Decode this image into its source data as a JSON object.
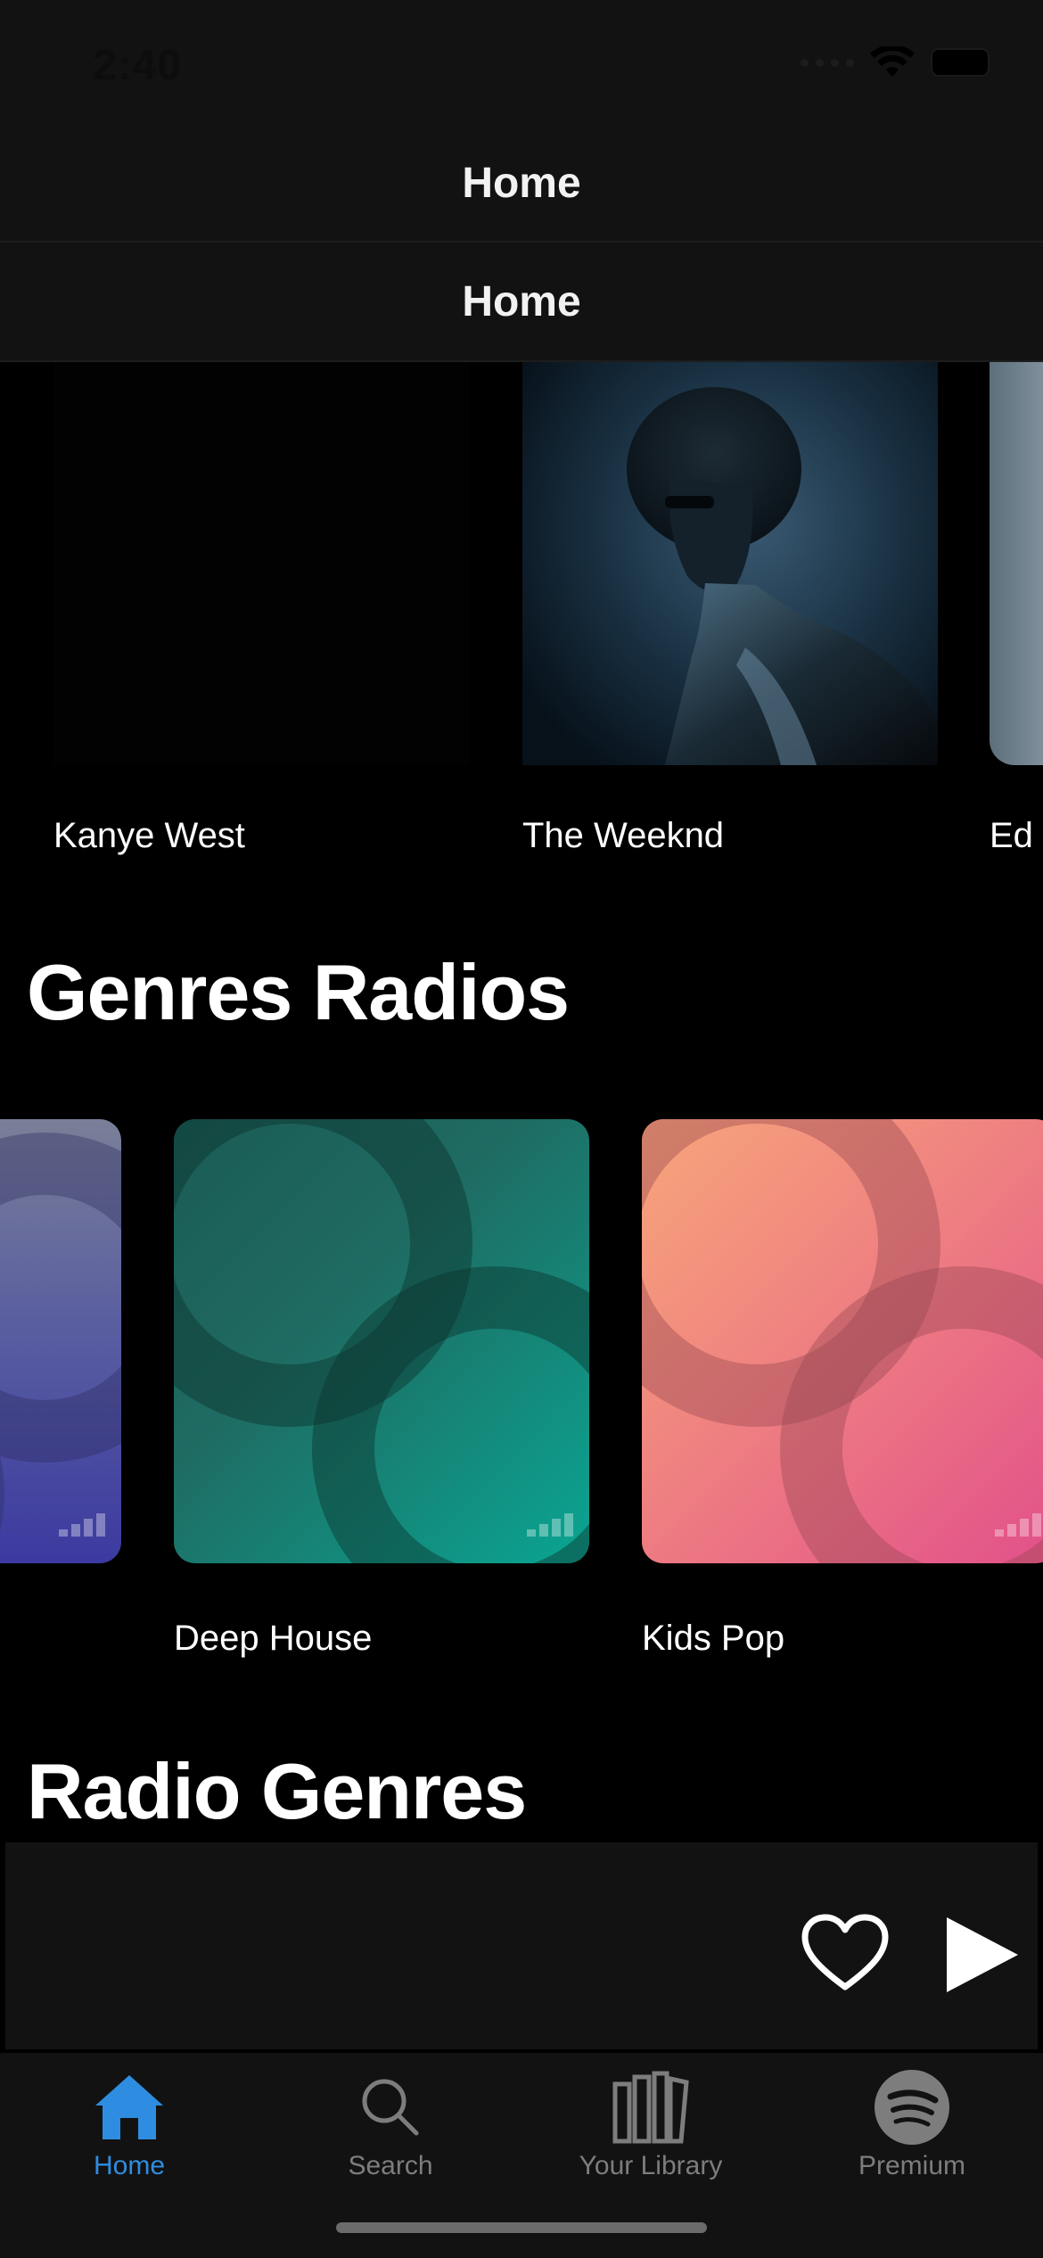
{
  "status_bar": {
    "time": "2:40"
  },
  "headers": {
    "primary_title": "Home",
    "secondary_title": "Home"
  },
  "artists": [
    {
      "name": "Kanye West"
    },
    {
      "name": "The Weeknd"
    },
    {
      "name": "Ed"
    }
  ],
  "sections": {
    "genres_radios_title": "Genres Radios",
    "radio_genres_title": "Radio Genres"
  },
  "genres": [
    {
      "name": "Deep House",
      "color": "#1f6b62"
    },
    {
      "name": "Kids Pop",
      "color": "#f08580"
    }
  ],
  "tab_bar": {
    "tabs": [
      {
        "label": "Home",
        "icon": "home-icon",
        "active": true
      },
      {
        "label": "Search",
        "icon": "search-icon",
        "active": false
      },
      {
        "label": "Your Library",
        "icon": "library-icon",
        "active": false
      },
      {
        "label": "Premium",
        "icon": "spotify-icon",
        "active": false
      }
    ],
    "active_color": "#2e8de0",
    "inactive_color": "#7d7d7d"
  }
}
